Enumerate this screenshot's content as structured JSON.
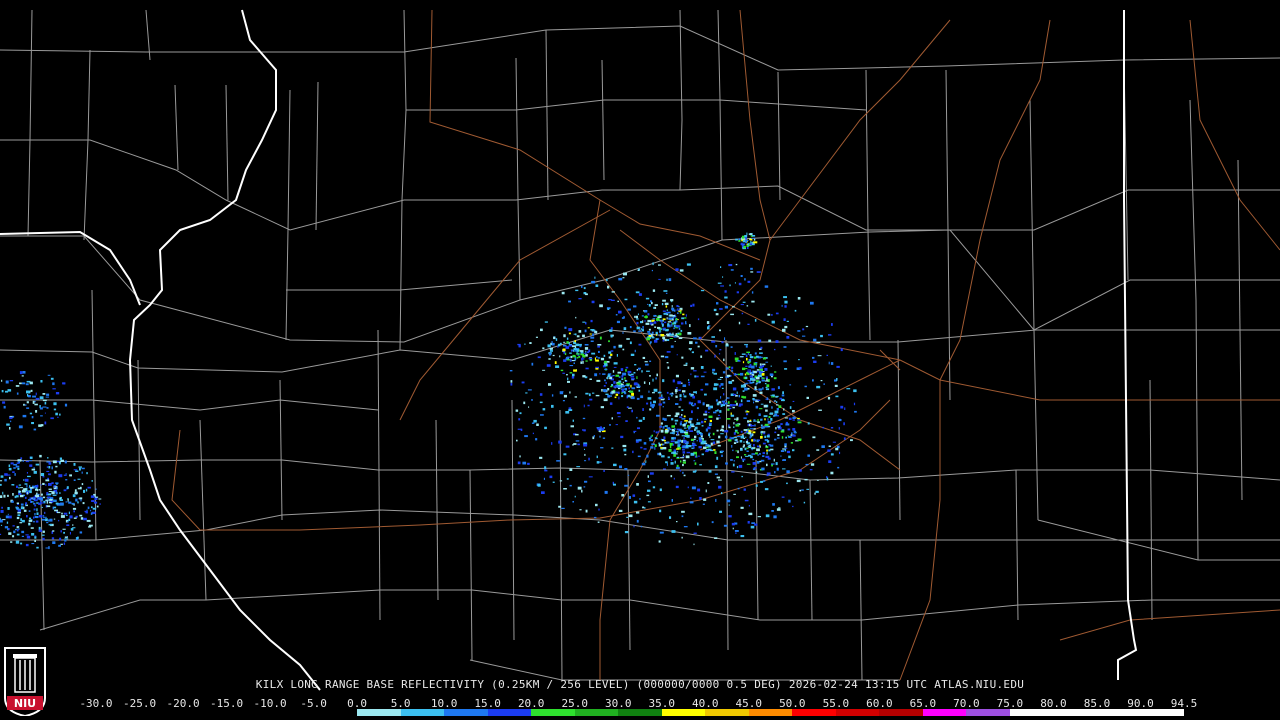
{
  "caption": "KILX LONG RANGE BASE REFLECTIVITY (0.25KM / 256 LEVEL) (000000/0000 0.5 DEG) 2026-02-24 13:15 UTC  ATLAS.NIU.EDU",
  "logo": {
    "icon": "niu-huskie-tower-icon",
    "text": "NIU",
    "color": "#c8102e"
  },
  "scale": {
    "labels": [
      "-30.0",
      "-25.0",
      "-20.0",
      "-15.0",
      "-10.0",
      "-5.0",
      "0.0",
      "5.0",
      "10.0",
      "15.0",
      "20.0",
      "25.0",
      "30.0",
      "35.0",
      "40.0",
      "45.0",
      "50.0",
      "55.0",
      "60.0",
      "65.0",
      "70.0",
      "75.0",
      "80.0",
      "85.0",
      "90.0",
      "94.5"
    ],
    "colors": [
      "#000000",
      "#000000",
      "#000000",
      "#000000",
      "#000000",
      "#000000",
      "#9ce8f0",
      "#3cc0f0",
      "#1e78f0",
      "#1b3cf0",
      "#2ee02e",
      "#20b020",
      "#108010",
      "#ffff00",
      "#f0c800",
      "#ff8c00",
      "#ff0000",
      "#d20000",
      "#b40000",
      "#ff00ff",
      "#9e50e0",
      "#ffffff",
      "#ffffff",
      "#ffffff",
      "#ffffff"
    ]
  },
  "map": {
    "state_border_color": "#ffffff",
    "county_border_color": "#9a9a9a",
    "highway_color": "#a05a32"
  }
}
